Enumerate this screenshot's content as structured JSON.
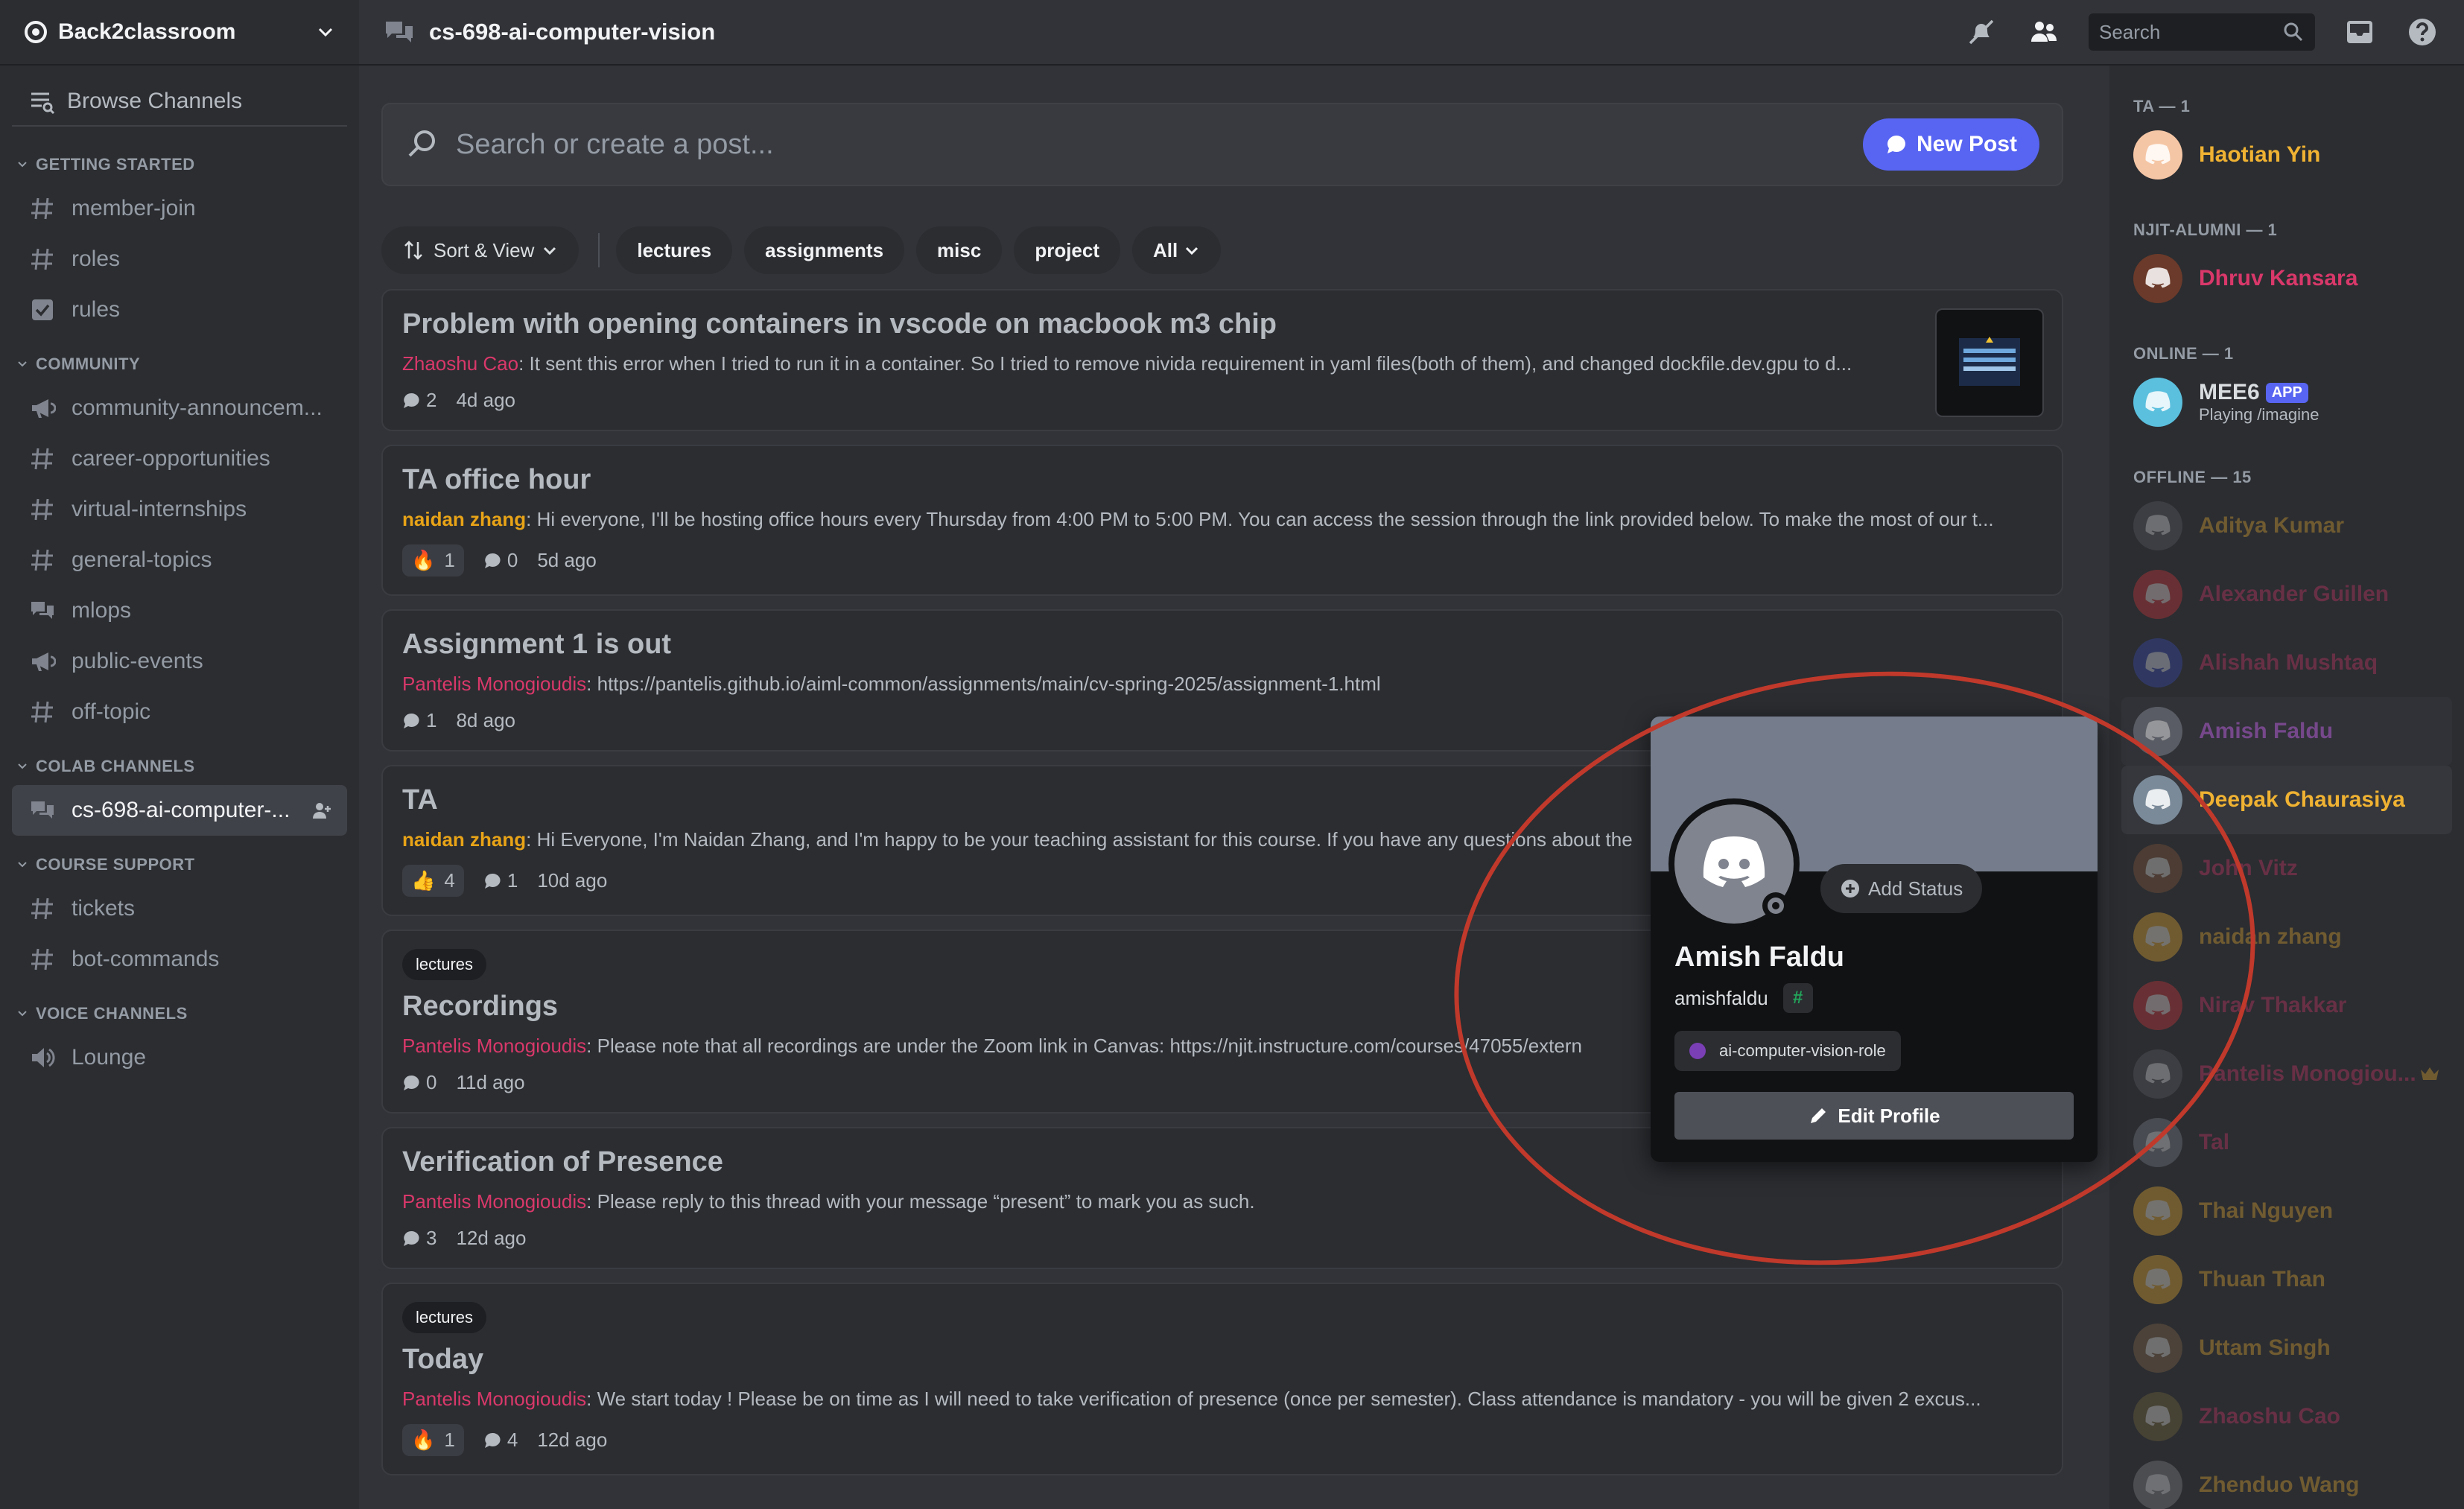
{
  "server": {
    "name": "Back2classroom"
  },
  "channel_title": "cs-698-ai-computer-vision",
  "topbar": {
    "search_placeholder": "Search"
  },
  "sidebar": {
    "browse_label": "Browse Channels",
    "categories": [
      {
        "name": "GETTING STARTED",
        "channels": [
          {
            "name": "member-join",
            "icon": "hash-icon"
          },
          {
            "name": "roles",
            "icon": "hash-icon"
          },
          {
            "name": "rules",
            "icon": "checkbox-icon"
          }
        ]
      },
      {
        "name": "COMMUNITY",
        "channels": [
          {
            "name": "community-announcem...",
            "icon": "megaphone-icon"
          },
          {
            "name": "career-opportunities",
            "icon": "hash-icon"
          },
          {
            "name": "virtual-internships",
            "icon": "hash-icon"
          },
          {
            "name": "general-topics",
            "icon": "hash-icon"
          },
          {
            "name": "mlops",
            "icon": "forum-icon"
          },
          {
            "name": "public-events",
            "icon": "megaphone-icon"
          },
          {
            "name": "off-topic",
            "icon": "hash-icon"
          }
        ]
      },
      {
        "name": "COLAB CHANNELS",
        "channels": [
          {
            "name": "cs-698-ai-computer-...",
            "icon": "forum-icon"
          }
        ]
      },
      {
        "name": "COURSE SUPPORT",
        "channels": [
          {
            "name": "tickets",
            "icon": "hash-icon"
          },
          {
            "name": "bot-commands",
            "icon": "hash-icon"
          }
        ]
      },
      {
        "name": "VOICE CHANNELS",
        "channels": [
          {
            "name": "Lounge",
            "icon": "speaker-icon"
          }
        ]
      }
    ]
  },
  "forum": {
    "search_placeholder": "Search or create a post...",
    "new_post_label": "New Post",
    "sort_label": "Sort & View",
    "tags": [
      "lectures",
      "assignments",
      "misc",
      "project"
    ],
    "all_label": "All"
  },
  "posts": [
    {
      "tag": "",
      "title": "Problem with opening containers in vscode on macbook m3 chip",
      "author": "Zhaoshu Cao",
      "author_color": "#d9386a",
      "body": ": It sent this error when I tried to run it in a container. So I tried to remove nivida requirement in yaml files(both of them), and changed dockfile.dev.gpu to d...",
      "reaction": "",
      "reaction_count": "",
      "comments": "2",
      "age": "4d ago"
    },
    {
      "tag": "",
      "title": "TA office hour",
      "author": "naidan zhang",
      "author_color": "#e8a317",
      "body": ": Hi everyone, I'll be hosting office hours every Thursday from 4:00 PM to 5:00 PM. You can access the session through the link provided below. To make the most of our t...",
      "reaction": "🔥",
      "reaction_count": "1",
      "comments": "0",
      "age": "5d ago"
    },
    {
      "tag": "",
      "title": "Assignment 1 is out",
      "author": "Pantelis Monogioudis",
      "author_color": "#d9386a",
      "body": ": https://pantelis.github.io/aiml-common/assignments/main/cv-spring-2025/assignment-1.html",
      "reaction": "",
      "reaction_count": "",
      "comments": "1",
      "age": "8d ago"
    },
    {
      "tag": "",
      "title": "TA",
      "author": "naidan zhang",
      "author_color": "#e8a317",
      "body": ": Hi Everyone, I'm Naidan Zhang, and I'm happy to be your teaching assistant for this course. If you have any questions about the",
      "reaction": "👍",
      "reaction_count": "4",
      "comments": "1",
      "age": "10d ago"
    },
    {
      "tag": "lectures",
      "title": "Recordings",
      "author": "Pantelis Monogioudis",
      "author_color": "#d9386a",
      "body": ": Please note that all recordings are under the Zoom link in Canvas: https://njit.instructure.com/courses/47055/extern",
      "reaction": "",
      "reaction_count": "",
      "comments": "0",
      "age": "11d ago"
    },
    {
      "tag": "",
      "title": "Verification of Presence",
      "author": "Pantelis Monogioudis",
      "author_color": "#d9386a",
      "body": ": Please reply to this thread with your message “present” to mark you as such.",
      "reaction": "",
      "reaction_count": "",
      "comments": "3",
      "age": "12d ago"
    },
    {
      "tag": "lectures",
      "title": "Today",
      "author": "Pantelis Monogioudis",
      "author_color": "#d9386a",
      "body": ": We start today ! Please be on time as I will need to take verification of presence (once per semester). Class attendance is mandatory - you will be given 2 excus...",
      "reaction": "🔥",
      "reaction_count": "1",
      "comments": "4",
      "age": "12d ago"
    }
  ],
  "members": {
    "groups": [
      {
        "label": "TA — 1",
        "items": [
          {
            "name": "Haotian Yin",
            "color": "#f0b232",
            "avatar_color": "#f5c6a5",
            "offline": false,
            "sub": ""
          }
        ]
      },
      {
        "label": "NJIT-ALUMNI — 1",
        "items": [
          {
            "name": "Dhruv Kansara",
            "color": "#d9386a",
            "avatar_color": "#6b3a2a",
            "offline": false,
            "sub": ""
          }
        ]
      },
      {
        "label": "ONLINE — 1",
        "items": [
          {
            "name": "MEE6",
            "color": "#dbdee1",
            "avatar_color": "#5bc0de",
            "offline": false,
            "sub": "Playing /imagine",
            "badge": "APP"
          }
        ]
      },
      {
        "label": "OFFLINE — 15",
        "items": [
          {
            "name": "Aditya Kumar",
            "color": "#f0b232",
            "avatar_color": "#5c5e66",
            "offline": true,
            "sub": ""
          },
          {
            "name": "Alexander Guillen",
            "color": "#d9386a",
            "avatar_color": "#da373c",
            "offline": true,
            "sub": ""
          },
          {
            "name": "Alishah Mushtaq",
            "color": "#d9386a",
            "avatar_color": "#3a4fbf",
            "offline": true,
            "sub": ""
          },
          {
            "name": "Amish Faldu",
            "color": "#b45fd6",
            "avatar_color": "#80848e",
            "offline": true,
            "sub": "",
            "highlight": true
          },
          {
            "name": "Deepak Chaurasiya",
            "color": "#f0b232",
            "avatar_color": "#7a8a99",
            "offline": false,
            "sub": "",
            "highlight": true
          },
          {
            "name": "John Vitz",
            "color": "#d9386a",
            "avatar_color": "#8a5a3a",
            "offline": true,
            "sub": ""
          },
          {
            "name": "naidan zhang",
            "color": "#f0b232",
            "avatar_color": "#f0b232",
            "offline": true,
            "sub": ""
          },
          {
            "name": "Nirav Thakkar",
            "color": "#d9386a",
            "avatar_color": "#da373c",
            "offline": true,
            "sub": ""
          },
          {
            "name": "Pantelis Monogiou...",
            "color": "#d9386a",
            "avatar_color": "#5c5e66",
            "offline": true,
            "sub": "",
            "crown": true
          },
          {
            "name": "Tal",
            "color": "#d9386a",
            "avatar_color": "#80848e",
            "offline": true,
            "sub": ""
          },
          {
            "name": "Thai Nguyen",
            "color": "#f0b232",
            "avatar_color": "#f0b232",
            "offline": true,
            "sub": ""
          },
          {
            "name": "Thuan Than",
            "color": "#f0b232",
            "avatar_color": "#f0b232",
            "offline": true,
            "sub": ""
          },
          {
            "name": "Uttam Singh",
            "color": "#f0b232",
            "avatar_color": "#8a6a4a",
            "offline": true,
            "sub": ""
          },
          {
            "name": "Zhaoshu Cao",
            "color": "#d9386a",
            "avatar_color": "#7a6a3a",
            "offline": true,
            "sub": ""
          },
          {
            "name": "Zhenduo Wang",
            "color": "#f0b232",
            "avatar_color": "#8a8a8a",
            "offline": true,
            "sub": ""
          }
        ]
      }
    ]
  },
  "popout": {
    "display_name": "Amish Faldu",
    "username": "amishfaldu",
    "add_status_label": "Add Status",
    "role": "ai-computer-vision-role",
    "edit_label": "Edit Profile"
  }
}
